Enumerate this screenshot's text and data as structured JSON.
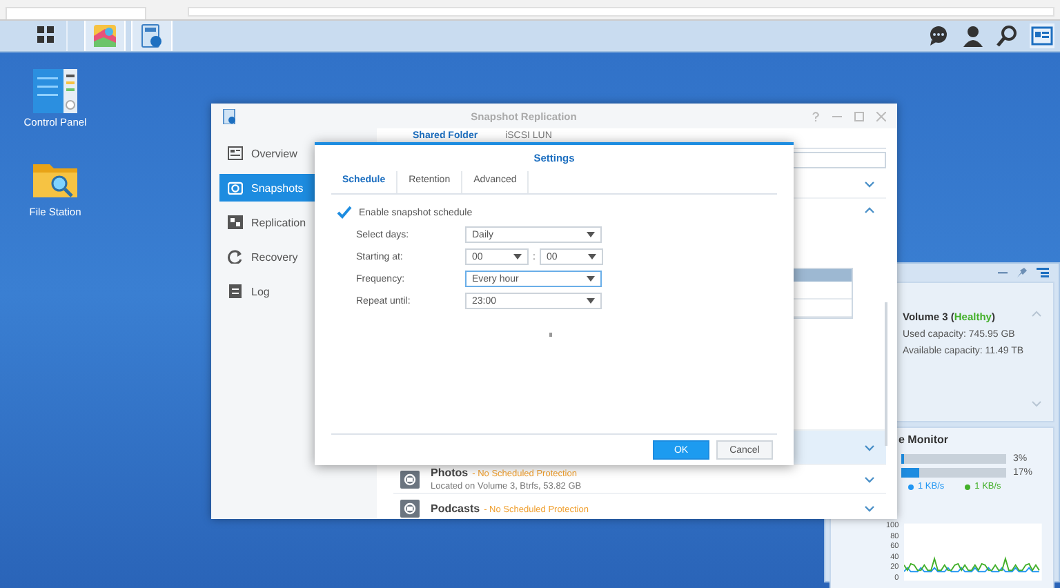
{
  "taskbar": {
    "apps": [
      {
        "kind": "main-menu",
        "selected": false
      },
      {
        "kind": "photo-app",
        "selected": true
      },
      {
        "kind": "snapshot-app",
        "selected": true
      }
    ],
    "tray": [
      {
        "kind": "chat",
        "selected": false
      },
      {
        "kind": "user",
        "selected": false
      },
      {
        "kind": "search",
        "selected": false
      },
      {
        "kind": "widgets",
        "selected": true
      }
    ]
  },
  "desktop_icons": [
    {
      "label": "Control Panel",
      "kind": "control-panel"
    },
    {
      "label": "File Station",
      "kind": "file-station"
    }
  ],
  "main_window": {
    "title": "Snapshot Replication",
    "sidebar": [
      {
        "label": "Overview",
        "kind": "overview",
        "selected": false
      },
      {
        "label": "Snapshots",
        "kind": "snapshots",
        "selected": true
      },
      {
        "label": "Replication",
        "kind": "replication",
        "selected": false
      },
      {
        "label": "Recovery",
        "kind": "recovery",
        "selected": false
      },
      {
        "label": "Log",
        "kind": "log",
        "selected": false
      }
    ],
    "tabs": [
      {
        "label": "Shared Folder",
        "selected": true
      },
      {
        "label": "iSCSI LUN",
        "selected": false
      }
    ],
    "folders": [
      {
        "name": "Photos",
        "status": "- No Scheduled Protection",
        "location": "Located on Volume 3, Btrfs, 53.82 GB"
      },
      {
        "name": "Podcasts",
        "status": "- No Scheduled Protection"
      }
    ]
  },
  "settings_dialog": {
    "title": "Settings",
    "tabs": [
      {
        "label": "Schedule",
        "selected": true
      },
      {
        "label": "Retention",
        "selected": false
      },
      {
        "label": "Advanced",
        "selected": false
      }
    ],
    "enable_schedule": {
      "label": "Enable snapshot schedule",
      "checked": true
    },
    "fields": [
      {
        "label": "Select days:",
        "kind": "select",
        "value": "Daily",
        "focused": false
      },
      {
        "label": "Starting at:",
        "kind": "time",
        "hour": "00",
        "separator": ":",
        "minute": "00"
      },
      {
        "label": "Frequency:",
        "kind": "select",
        "value": "Every hour",
        "focused": true
      },
      {
        "label": "Repeat until:",
        "kind": "select",
        "value": "23:00",
        "focused": false
      }
    ],
    "buttons": [
      {
        "label": "OK",
        "kind": "primary"
      },
      {
        "label": "Cancel",
        "kind": "secondary"
      }
    ]
  },
  "widget": {
    "volume": {
      "title": "Volume 3 (**Healthy**)",
      "used": "Used capacity: 745.95 GB",
      "available": "Available capacity: 11.49 TB"
    },
    "monitor": {
      "title": "e Monitor",
      "meters": [
        {
          "level": 0.03,
          "reading": "3%"
        },
        {
          "level": 0.17,
          "reading": "17%"
        }
      ],
      "network": [
        {
          "value": "1 KB/s",
          "color": "#2196f3"
        },
        {
          "value": "1 KB/s",
          "color": "#43b02a"
        }
      ],
      "ticks": [
        "100",
        "80",
        "60",
        "40",
        "20",
        "0"
      ]
    }
  }
}
